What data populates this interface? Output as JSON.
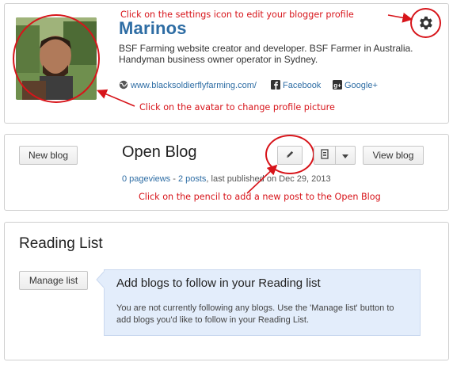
{
  "profile": {
    "name": "Marinos",
    "bio": "BSF Farming website creator and developer. BSF Farmer in Australia. Handyman business owner operator in Sydney.",
    "links": {
      "website": "www.blacksoldierflyfarming.com/",
      "facebook": "Facebook",
      "googleplus": "Google+"
    }
  },
  "annotations": {
    "settings": "Click on the settings icon to edit your blogger profile",
    "avatar": "Click on the avatar to change profile picture",
    "pencil": "Click on the pencil to add a new post to the Open Blog"
  },
  "blog": {
    "new_blog_label": "New blog",
    "title": "Open Blog",
    "pageviews": "0 pageviews",
    "separator": " - ",
    "posts": "2 posts",
    "published": ", last published on Dec 29, 2013",
    "view_blog_label": "View blog"
  },
  "reading": {
    "title": "Reading List",
    "manage_label": "Manage list",
    "heading": "Add blogs to follow in your Reading list",
    "text": "You are not currently following any blogs. Use the 'Manage list' button to add blogs you'd like to follow in your Reading List."
  },
  "colors": {
    "annotation": "#d7141a",
    "link": "#2e6da4",
    "info_box": "#e3edfb"
  }
}
